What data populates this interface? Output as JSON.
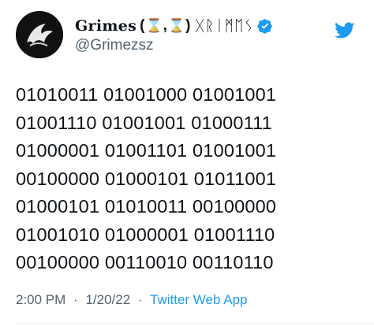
{
  "author": {
    "display_name": "Grimes",
    "name_open": "(",
    "hourglass_1": "⌛",
    "name_comma": ",",
    "hourglass_2": "⌛",
    "name_close": ")",
    "name_runes": "ᚷᚱᛁᛗᛖᛊ",
    "handle": "@Grimezsz",
    "verified_icon": "verified-badge-icon",
    "verified_color": "#1d9bf0"
  },
  "brand": {
    "logo_icon": "twitter-bird-icon",
    "color": "#1d9bf0"
  },
  "tweet": {
    "lines": [
      "01010011 01001000 01001001",
      "01001110 01001001 01000111",
      "01000001 01001101 01001001",
      "00100000 01000101 01011001",
      "01000101 01010011 00100000",
      "01001010 01000001 01001110",
      "00100000 00110010 00110110"
    ]
  },
  "meta": {
    "time": "2:00 PM",
    "separator": "·",
    "date": "1/20/22",
    "source": "Twitter Web App"
  }
}
